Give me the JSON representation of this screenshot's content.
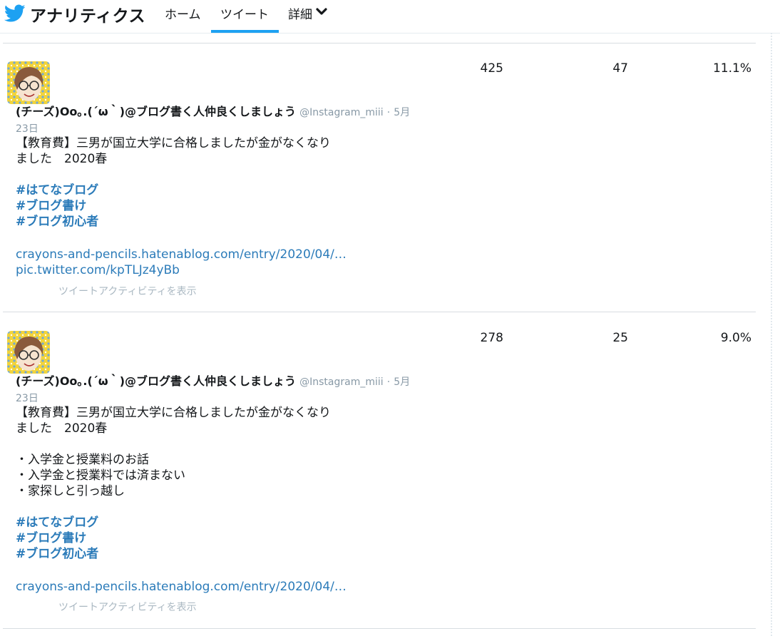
{
  "header": {
    "brand": "アナリティクス",
    "tabs": [
      {
        "label": "ホーム"
      },
      {
        "label": "ツイート",
        "active": true
      },
      {
        "label": "詳細"
      }
    ],
    "accent_color": "#1da1f2"
  },
  "tweets": [
    {
      "author_name": "(チーズ)Oo｡.(´ω｀)@ブログ書く人仲良くしましょう",
      "handle": "@Instagram_miii",
      "date_part1": "5月",
      "date_part2": "23日",
      "lines": [
        "【教育費】三男が国立大学に合格しましたが金がなくなり",
        "ました　2020春"
      ],
      "bullets": [],
      "hashtags": [
        "#はてなブログ",
        "#ブログ書け",
        "#ブログ初心者"
      ],
      "links": [
        "crayons-and-pencils.hatenablog.com/entry/2020/04/…",
        "pic.twitter.com/kpTLJz4yBb"
      ],
      "activity_label": "ツイートアクティビティを表示",
      "impressions": "425",
      "engagements": "47",
      "engagement_rate": "11.1%"
    },
    {
      "author_name": "(チーズ)Oo｡.(´ω｀)@ブログ書く人仲良くしましょう",
      "handle": "@Instagram_miii",
      "date_part1": "5月",
      "date_part2": "23日",
      "lines": [
        "【教育費】三男が国立大学に合格しましたが金がなくなり",
        "ました　2020春"
      ],
      "bullets": [
        "・入学金と授業料のお話",
        "・入学金と授業料では済まない",
        "・家探しと引っ越し"
      ],
      "hashtags": [
        "#はてなブログ",
        "#ブログ書け",
        "#ブログ初心者"
      ],
      "links": [
        "crayons-and-pencils.hatenablog.com/entry/2020/04/…"
      ],
      "activity_label": "ツイートアクティビティを表示",
      "impressions": "278",
      "engagements": "25",
      "engagement_rate": "9.0%"
    }
  ],
  "colors": {
    "hashtag": "#2b7bb9",
    "link": "#2b7bb9",
    "muted": "#8899a6",
    "activity": "#aab8c2"
  }
}
